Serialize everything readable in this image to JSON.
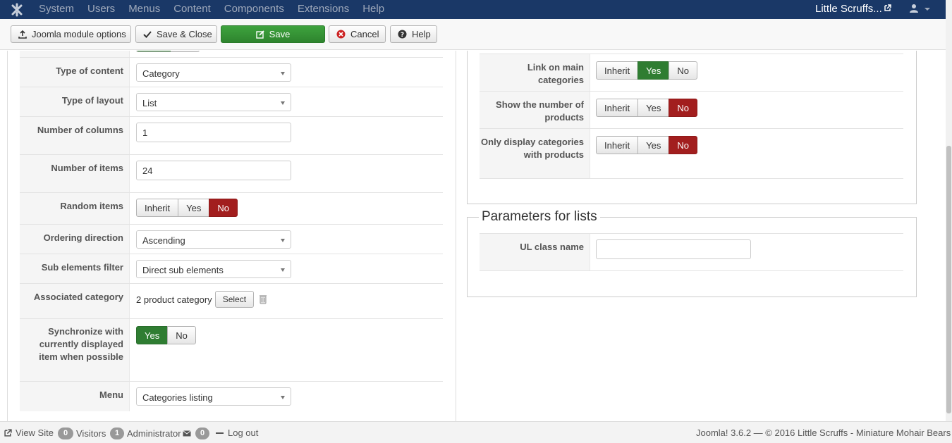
{
  "topnav": {
    "menu": [
      "System",
      "Users",
      "Menus",
      "Content",
      "Components",
      "Extensions",
      "Help"
    ],
    "site_name": "Little Scruffs...",
    "icons": [
      "joomla-logo-icon",
      "external-link-icon",
      "user-icon",
      "caret-down-icon"
    ]
  },
  "toolbar": {
    "module_options_label": "Joomla module options",
    "save_close_label": "Save & Close",
    "save_label": "Save",
    "cancel_label": "Cancel",
    "help_label": "Help"
  },
  "left_form": {
    "type_of_content": {
      "label": "Type of content",
      "value": "Category"
    },
    "type_of_layout": {
      "label": "Type of layout",
      "value": "List"
    },
    "number_of_columns": {
      "label": "Number of columns",
      "value": "1"
    },
    "number_of_items": {
      "label": "Number of items",
      "value": "24"
    },
    "random_items": {
      "label": "Random items",
      "options": [
        "Inherit",
        "Yes",
        "No"
      ],
      "selected": "No"
    },
    "ordering_direction": {
      "label": "Ordering direction",
      "value": "Ascending"
    },
    "sub_elements_filter": {
      "label": "Sub elements filter",
      "value": "Direct sub elements"
    },
    "associated_category": {
      "label": "Associated category",
      "value": "2 product category",
      "button": "Select"
    },
    "synchronize": {
      "label": "Synchronize with currently displayed item when possible",
      "options": [
        "Yes",
        "No"
      ],
      "selected": "Yes"
    },
    "menu": {
      "label": "Menu",
      "value": "Categories listing"
    }
  },
  "right_form": {
    "link_on_main_categories": {
      "label": "Link on main categories",
      "options": [
        "Inherit",
        "Yes",
        "No"
      ],
      "selected": "Yes"
    },
    "show_number_of_products": {
      "label": "Show the number of products",
      "options": [
        "Inherit",
        "Yes",
        "No"
      ],
      "selected": "No"
    },
    "only_display_categories": {
      "label": "Only display categories with products",
      "options": [
        "Inherit",
        "Yes",
        "No"
      ],
      "selected": "No"
    },
    "lists_legend": "Parameters for lists",
    "ul_class_name": {
      "label": "UL class name",
      "value": ""
    }
  },
  "footer": {
    "view_site": "View Site",
    "visitors_count": "0",
    "visitors_label": "Visitors",
    "admin_count": "1",
    "admin_label": "Administrator",
    "messages_count": "0",
    "logout_label": "Log out",
    "copyright": "Joomla! 3.6.2  —  © 2016 Little Scruffs - Miniature Mohair Bears"
  },
  "colors": {
    "nav_bg": "#1a3867",
    "success": "#2f7d32",
    "danger": "#a21e1e"
  }
}
